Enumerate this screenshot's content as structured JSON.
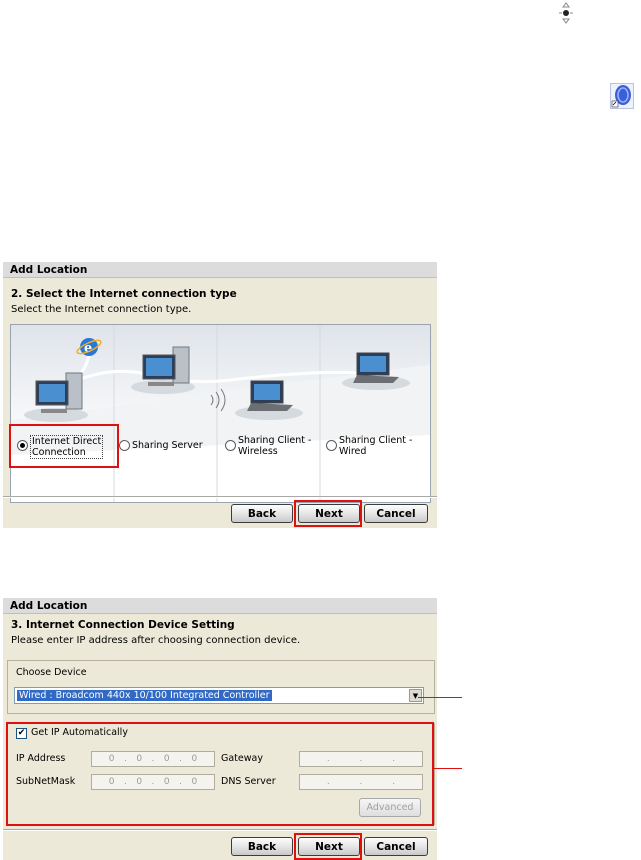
{
  "icons": {
    "move": "move-crosshair-icon",
    "app": "network-app-icon"
  },
  "dialog1": {
    "title": "Add Location",
    "step_title": "2. Select the Internet connection type",
    "step_sub": "Select the Internet connection type.",
    "options": [
      {
        "label": "Internet Direct\nConnection",
        "selected": true
      },
      {
        "label": "Sharing Server",
        "selected": false
      },
      {
        "label": "Sharing Client -\nWireless",
        "selected": false
      },
      {
        "label": "Sharing Client -\nWired",
        "selected": false
      }
    ],
    "buttons": {
      "back": "Back",
      "next": "Next",
      "cancel": "Cancel"
    }
  },
  "dialog2": {
    "title": "Add Location",
    "step_title": "3. Internet Connection Device Setting",
    "step_sub": "Please enter IP address after choosing connection device.",
    "choose_device_label": "Choose Device",
    "device_value": "Wired : Broadcom 440x 10/100 Integrated Controller",
    "get_ip_auto_label": "Get IP Automatically",
    "get_ip_auto_checked": true,
    "fields": {
      "ip_address": {
        "label": "IP Address",
        "value": [
          "0",
          "0",
          "0",
          "0"
        ]
      },
      "gateway": {
        "label": "Gateway",
        "value": [
          "",
          "",
          "",
          ""
        ]
      },
      "subnet_mask": {
        "label": "SubNetMask",
        "value": [
          "0",
          "0",
          "0",
          "0"
        ]
      },
      "dns_server": {
        "label": "DNS Server",
        "value": [
          "",
          "",
          "",
          ""
        ]
      }
    },
    "advanced_label": "Advanced",
    "buttons": {
      "back": "Back",
      "next": "Next",
      "cancel": "Cancel"
    }
  },
  "colors": {
    "highlight": "#e01010",
    "selection": "#316ac5",
    "dialog_bg": "#ece9d8"
  }
}
